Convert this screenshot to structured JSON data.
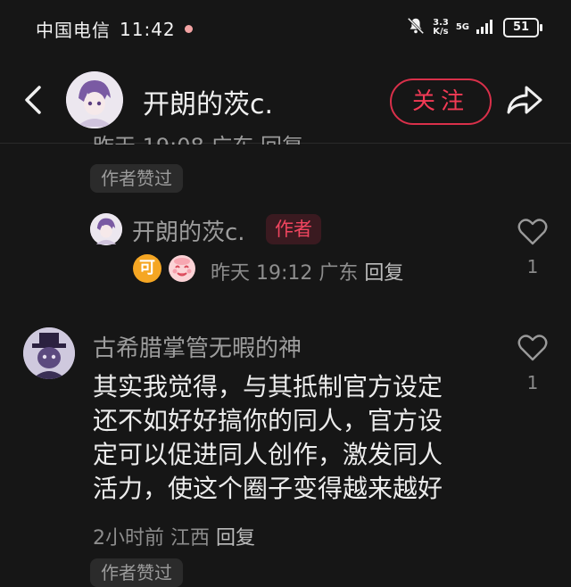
{
  "status_bar": {
    "carrier": "中国电信",
    "time": "11:42",
    "net_speed_value": "3.3",
    "net_speed_unit": "K/s",
    "network_type": "5G",
    "battery": "51"
  },
  "header": {
    "user_name": "开朗的茨c.",
    "follow_label": "关注"
  },
  "previous_reply": {
    "meta_clipped": "昨天 19:08 广东 回复",
    "chip": "作者赞过"
  },
  "author_reply": {
    "name": "开朗的茨c.",
    "badge": "作者",
    "emoji_1": "可",
    "time": "昨天 19:12",
    "location": "广东",
    "reply_label": "回复",
    "likes": "1"
  },
  "comment": {
    "name": "古希腊掌管无暇的神",
    "lines": [
      "其实我觉得，与其抵制官方设定",
      "还不如好好搞你的同人，官方设",
      "定可以促进同人创作，激发同人",
      "活力，使这个圈子变得越来越好"
    ],
    "time": "2小时前",
    "location": "江西",
    "reply_label": "回复",
    "likes": "1",
    "chip": "作者赞过"
  },
  "colors": {
    "background": "#161616",
    "accent_red": "#f23a55",
    "muted_text": "#9d9d9d"
  },
  "icons": {
    "back": "chevron-left-icon",
    "share": "share-arrow-icon",
    "like": "heart-outline-icon",
    "mute": "bell-off-icon",
    "signal": "signal-bars-icon"
  }
}
